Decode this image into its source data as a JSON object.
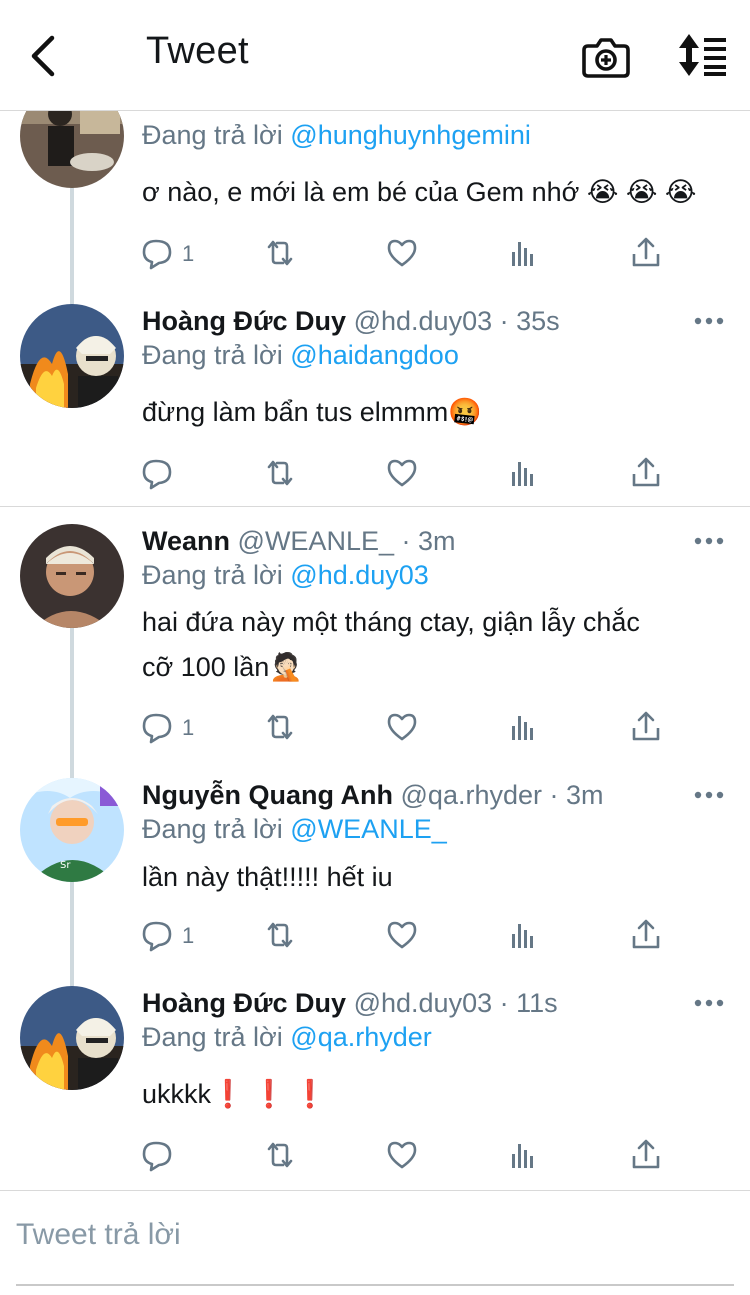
{
  "header": {
    "title": "Tweet",
    "back_icon": "chevron-left-icon",
    "camera_icon": "camera-plus-icon",
    "sort_icon": "sort-icon"
  },
  "colors": {
    "accent": "#1da1f2",
    "text": "#14171a",
    "muted": "#657786",
    "thread": "#cfd9de"
  },
  "tweets": [
    {
      "name": "",
      "handle": "",
      "time": "",
      "reply_prefix": "Đang trả lời",
      "reply_to": "@hunghuynhgemini",
      "text": "ơ nào, e mới là em bé của Gem nhớ 😭 😭 😭",
      "replies": "1"
    },
    {
      "name": "Hoàng Đức Duy",
      "handle": "@hd.duy03",
      "time": "· 35s",
      "reply_prefix": "Đang trả lời",
      "reply_to": "@haidangdoo",
      "text": "đừng làm bẩn tus elmmm🤬",
      "replies": ""
    },
    {
      "name": "Weann",
      "handle": "@WEANLE_",
      "time": "· 3m",
      "reply_prefix": "Đang trả lời",
      "reply_to": "@hd.duy03",
      "text_line1": "hai đứa này một tháng ctay, giận lẫy chắc",
      "text_line2": "cỡ 100 lần🤦🏻",
      "replies": "1"
    },
    {
      "name": "Nguyễn Quang Anh",
      "handle": "@qa.rhyder",
      "time": "· 3m",
      "reply_prefix": "Đang trả lời",
      "reply_to": "@WEANLE_",
      "text": "lần này thật!!!!! hết iu",
      "replies": "1"
    },
    {
      "name": "Hoàng Đức Duy",
      "handle": "@hd.duy03",
      "time": "· 11s",
      "reply_prefix": "Đang trả lời",
      "reply_to": "@qa.rhyder",
      "text": "ukkkk❗ ❗ ❗",
      "replies": ""
    }
  ],
  "composer": {
    "placeholder": "Tweet trả lời"
  }
}
